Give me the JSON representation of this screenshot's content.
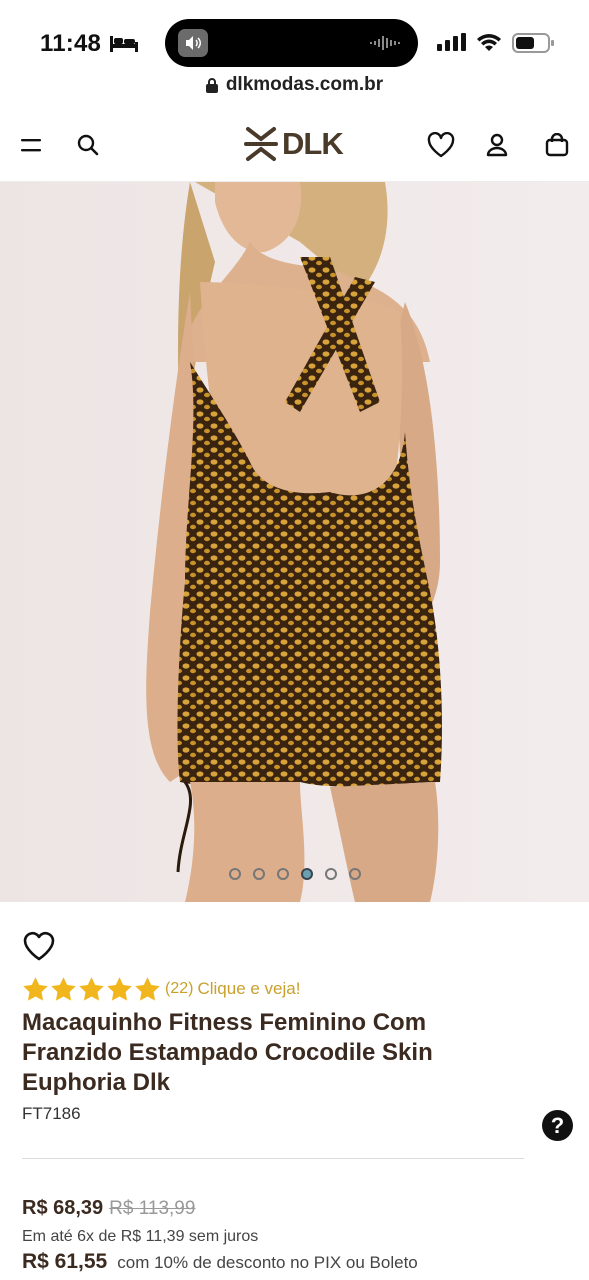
{
  "status_bar": {
    "time": "11:48"
  },
  "browser": {
    "url": "dlkmodas.com.br"
  },
  "header": {
    "logo_text": "DLK"
  },
  "gallery": {
    "dot_count": 6,
    "active_index": 3
  },
  "product": {
    "rating": {
      "stars": 5,
      "count_text": "(22)",
      "link_text": "Clique e veja!"
    },
    "title": "Macaquinho Fitness Feminino Com Franzido Estampado Crocodile Skin Euphoria Dlk",
    "sku": "FT7186",
    "price": "R$ 68,39",
    "old_price": "R$ 113,99",
    "installments": "Em até 6x de R$ 11,39 sem juros",
    "pix_price": "R$ 61,55",
    "pix_text": "com 10% de desconto no PIX ou Boleto"
  },
  "help_label": "?",
  "colors": {
    "brand_brown": "#3b2a20",
    "star_gold": "#f2b61d",
    "link_gold": "#c8a12c"
  }
}
